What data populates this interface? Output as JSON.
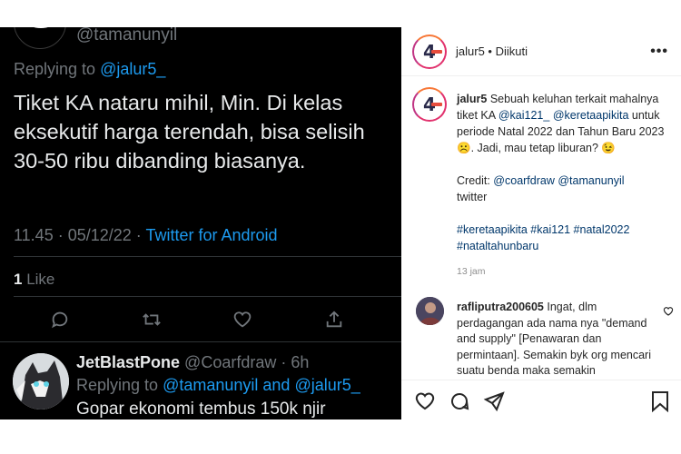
{
  "twitter": {
    "top_handle": "@tamanunyil",
    "replying_prefix": "Replying to ",
    "replying_to": "@jalur5_",
    "tweet_text": "Tiket KA nataru mihil, Min. Di kelas eksekutif harga terendah, bisa selisih 30-50 ribu dibanding biasanya.",
    "meta_time": "11.45 · 05/12/22 · ",
    "meta_source": "Twitter for Android",
    "likes_count": "1",
    "likes_label": " Like",
    "reply": {
      "name": "JetBlastPone",
      "handle": " @Coarfdraw · 6h",
      "replying_prefix": "Replying to ",
      "replying_user1": "@tamanunyil",
      "replying_and": " and ",
      "replying_user2": "@jalur5_",
      "text": "Gopar ekonomi tembus 150k njir"
    },
    "colors": {
      "link": "#1d9bf0",
      "muted": "#71767b",
      "text": "#e7e9ea",
      "bg": "#000000"
    }
  },
  "instagram": {
    "logo_text": "4",
    "username": "jalur5",
    "separator": " • ",
    "follow_status": "Diikuti",
    "more_label": "•••",
    "caption": {
      "username": "jalur5",
      "text1": " Sebuah keluhan terkait mahalnya tiket KA ",
      "mention1": "@kai121_",
      "space": " ",
      "mention2": "@keretaapikita",
      "text2": " untuk periode Natal 2022 dan Tahun Baru 2023 ☹️. Jadi, mau tetap liburan? 😉",
      "credit_label": "Credit: ",
      "credit1": "@coarfdraw",
      "credit2": "@tamanunyil",
      "credit_suffix": "twitter",
      "hashtags": "#keretaapikita #kai121 #natal2022 #nataltahunbaru"
    },
    "time_ago": "13 jam",
    "comment": {
      "username": "rafliputra200605",
      "text": " Ingat, dlm perdagangan ada nama nya \"demand and supply\" [Penawaran dan permintaan]. Semakin byk org mencari suatu benda maka semakin"
    },
    "colors": {
      "link": "#00376b",
      "muted": "#8e8e8e",
      "ring": "#e1306c"
    }
  }
}
